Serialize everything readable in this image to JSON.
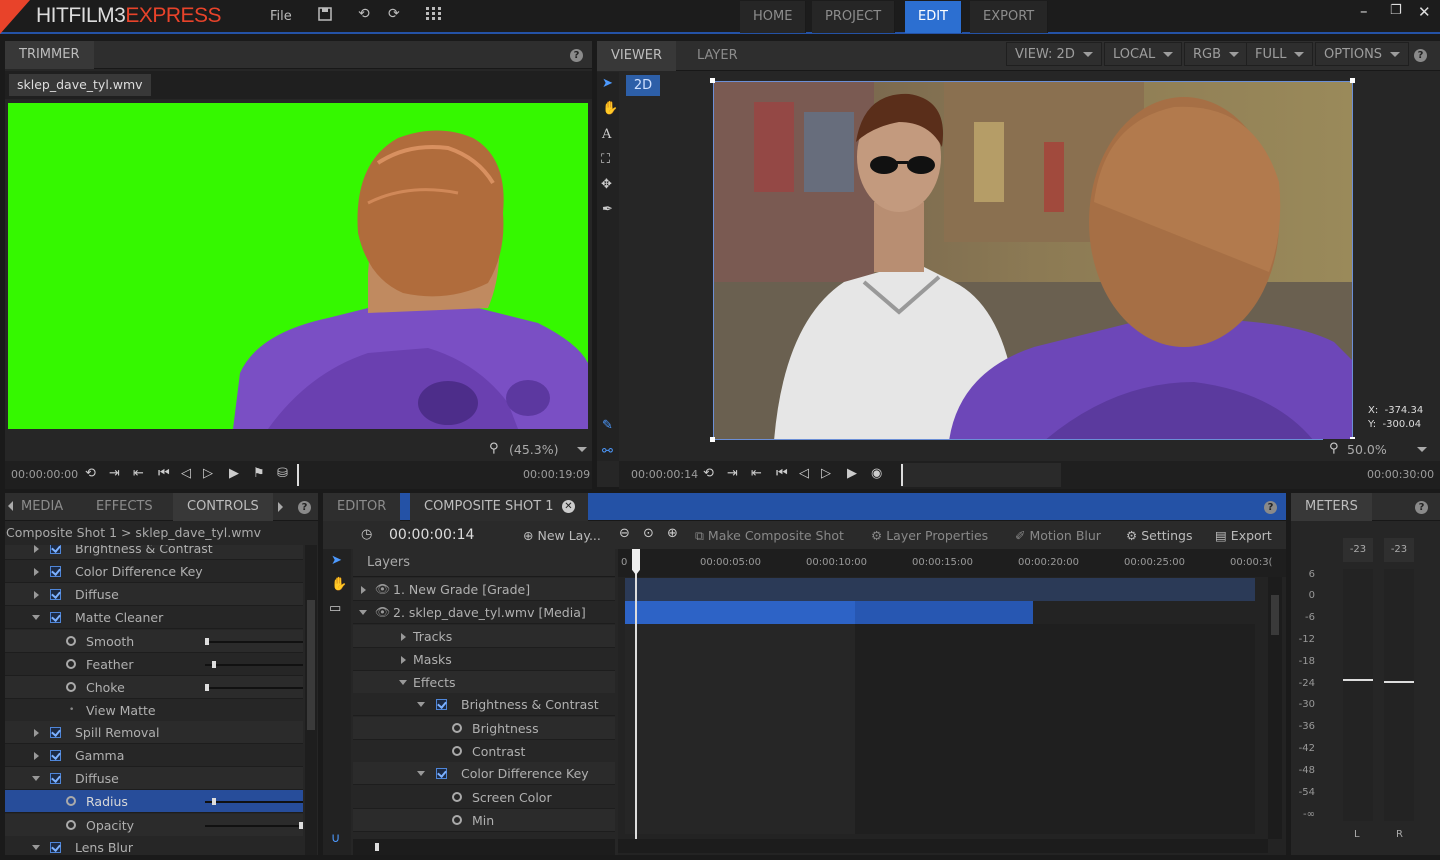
{
  "app": {
    "logo_main": "HITFILM3",
    "logo_accent": "EXPRESS",
    "menu_file": "File"
  },
  "nav_tabs": [
    {
      "label": "HOME"
    },
    {
      "label": "PROJECT"
    },
    {
      "label": "EDIT"
    },
    {
      "label": "EXPORT"
    }
  ],
  "active_tab": "EDIT",
  "trimmer": {
    "title": "TRIMMER",
    "file_tab": "sklep_dave_tyl.wmv",
    "zoom": "(45.3%)",
    "time_start": "00:00:00:00",
    "time_end": "00:00:19:09"
  },
  "viewer": {
    "tabs": [
      "VIEWER",
      "LAYER"
    ],
    "dropdowns": [
      "VIEW: 2D",
      "LOCAL",
      "RGB",
      "FULL",
      "OPTIONS"
    ],
    "mode_badge": "2D",
    "coord_x_label": "X:",
    "coord_x": "-374.34",
    "coord_y_label": "Y:",
    "coord_y": "-300.04",
    "zoom": "50.0%",
    "time_current": "00:00:00:14",
    "time_end": "00:00:30:00"
  },
  "controls": {
    "tabs": [
      "MEDIA",
      "EFFECTS",
      "CONTROLS"
    ],
    "breadcrumb": "Composite Shot 1 > sklep_dave_tyl.wmv",
    "rows": [
      {
        "label": "Brightness & Contrast"
      },
      {
        "label": "Color Difference Key"
      },
      {
        "label": "Diffuse"
      },
      {
        "label": "Matte Cleaner"
      },
      {
        "label": "Smooth"
      },
      {
        "label": "Feather"
      },
      {
        "label": "Choke"
      },
      {
        "label": "View Matte"
      },
      {
        "label": "Spill Removal"
      },
      {
        "label": "Gamma"
      },
      {
        "label": "Diffuse"
      },
      {
        "label": "Radius"
      },
      {
        "label": "Opacity"
      },
      {
        "label": "Lens Blur"
      }
    ]
  },
  "editor": {
    "tabs": [
      "EDITOR",
      "COMPOSITE SHOT 1"
    ],
    "timecode": "00:00:00:14",
    "toolbar": {
      "new_layer": "New Lay...",
      "make_composite": "Make Composite Shot",
      "layer_properties": "Layer Properties",
      "motion_blur": "Motion Blur",
      "settings": "Settings",
      "export": "Export"
    },
    "layers_header": "Layers",
    "ruler": [
      "0",
      "00:00:05:00",
      "00:00:10:00",
      "00:00:15:00",
      "00:00:20:00",
      "00:00:25:00",
      "00:00:3("
    ],
    "layer_rows": [
      {
        "label": "1. New Grade [Grade]"
      },
      {
        "label": "2. sklep_dave_tyl.wmv [Media]"
      },
      {
        "label": "Tracks"
      },
      {
        "label": "Masks"
      },
      {
        "label": "Effects"
      },
      {
        "label": "Brightness & Contrast"
      },
      {
        "label": "Brightness"
      },
      {
        "label": "Contrast"
      },
      {
        "label": "Color Difference Key"
      },
      {
        "label": "Screen Color"
      },
      {
        "label": "Min"
      }
    ]
  },
  "meters": {
    "title": "METERS",
    "peak_l": "-23",
    "peak_r": "-23",
    "scale": [
      "6",
      "0",
      "-6",
      "-12",
      "-18",
      "-24",
      "-30",
      "-36",
      "-42",
      "-48",
      "-54",
      "-∞"
    ],
    "channel_l": "L",
    "channel_r": "R"
  },
  "colors": {
    "accent": "#2c6fd1",
    "green_screen": "#33ff00",
    "logo_red": "#e8432a"
  }
}
